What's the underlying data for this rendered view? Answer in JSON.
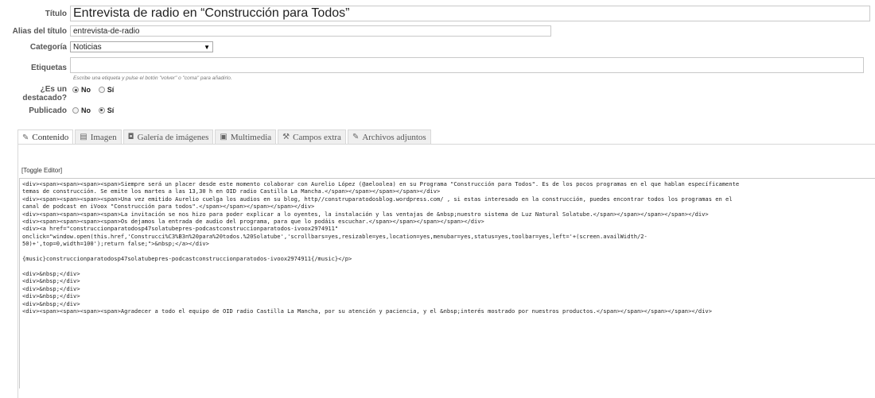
{
  "form": {
    "title_label": "Título",
    "title_value": "Entrevista de radio en “Construcción para Todos”",
    "alias_label": "Alias del título",
    "alias_value": "entrevista-de-radio",
    "category_label": "Categoría",
    "category_value": "Noticias",
    "tags_label": "Etiquetas",
    "tags_value": "",
    "tags_hint": "Escribe una etiqueta y pulse el botón \"volver\" o \"coma\" para añadirlo.",
    "featured_label_1": "¿Es un",
    "featured_label_2": "destacado?",
    "published_label": "Publicado",
    "no_label": "No",
    "yes_label": "Sí"
  },
  "tabs": [
    {
      "label": "Contenido",
      "icon": "edit-icon"
    },
    {
      "label": "Imagen",
      "icon": "image-icon"
    },
    {
      "label": "Galería de imágenes",
      "icon": "camera-icon"
    },
    {
      "label": "Multimedia",
      "icon": "film-icon"
    },
    {
      "label": "Campos extra",
      "icon": "tools-icon"
    },
    {
      "label": "Archivos adjuntos",
      "icon": "paperclip-icon"
    }
  ],
  "editor": {
    "toggle_label": "[Toggle Editor]",
    "lines": [
      "<div><span><span><span><span>Siempre será un placer desde este momento colaborar con Aurelio López (@aeloolea) en su Programa \"Construcción para Todos\". Es de los pocos programas en el que hablan específicamente",
      "temas de construcción. Se emite los martes a las 13,30 h en OID radio Castilla La Mancha.</span></span></span></span></div>",
      "<div><span><span><span><span>Una vez emitido Aurelio cuelga los audios en su blog, http//construparatodosblog.wordpress.com/ , si estas interesado en la construcción, puedes encontrar todos los programas en el",
      "canal de podcast en iVoox \"Construcción para todos\".</span></span></span></span></div>",
      "<div><span><span><span><span>La invitación se nos hizo para poder explicar a lo oyentes, la instalación y las ventajas de &nbsp;nuestro sistema de Luz Natural Solatube.</span></span></span></span></div>",
      "<div><span><span><span><span>Os dejamos la entrada de audio del programa, para que lo podáis escuchar.</span></span></span></span></div>",
      "<div><a href=\"construccionparatodosp47solatubepres-podcastconstruccionparatodos-ivoox2974911\"",
      "onclick=\"window.open(this.href,'Construcci%C3%B3n%20para%20todos.%20Solatube','scrollbars=yes,resizable=yes,location=yes,menubar=yes,status=yes,toolbar=yes,left='+(screen.availWidth/2-",
      "50)+',top=0,width=100');return false;\">&nbsp;</a></div>",
      "",
      "{music}construccionparatodosp47solatubepres-podcastconstruccionparatodos-ivoox2974911{/music}</p>",
      "",
      "<div>&nbsp;</div>",
      "<div>&nbsp;</div>",
      "<div>&nbsp;</div>",
      "<div>&nbsp;</div>",
      "<div>&nbsp;</div>",
      "<div><span><span><span><span>Agradecer a todo el equipo de OID radio Castilla La Mancha, por su atención y paciencia, y el &nbsp;interés mostrado por nuestros productos.</span></span></span></span></div>"
    ]
  }
}
